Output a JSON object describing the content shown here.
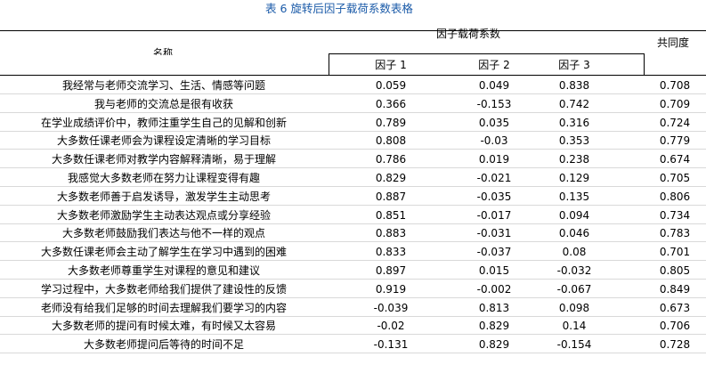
{
  "caption": "表 6 旋转后因子载荷系数表格",
  "header": {
    "name_label": "名称",
    "group_label": "因子载荷系数",
    "factor_labels": [
      "因子 1",
      "因子 2",
      "因子 3"
    ],
    "communality_label": "共同度"
  },
  "rows": [
    {
      "name": "我经常与老师交流学习、生活、情感等问题",
      "f1": "0.059",
      "f2": "0.049",
      "f3": "0.838",
      "h": "0.708"
    },
    {
      "name": "我与老师的交流总是很有收获",
      "f1": "0.366",
      "f2": "-0.153",
      "f3": "0.742",
      "h": "0.709"
    },
    {
      "name": "在学业成绩评价中，教师注重学生自己的见解和创新",
      "f1": "0.789",
      "f2": "0.035",
      "f3": "0.316",
      "h": "0.724"
    },
    {
      "name": "大多数任课老师会为课程设定清晰的学习目标",
      "f1": "0.808",
      "f2": "-0.03",
      "f3": "0.353",
      "h": "0.779"
    },
    {
      "name": "大多数任课老师对教学内容解释清晰，易于理解",
      "f1": "0.786",
      "f2": "0.019",
      "f3": "0.238",
      "h": "0.674"
    },
    {
      "name": "我感觉大多数老师在努力让课程变得有趣",
      "f1": "0.829",
      "f2": "-0.021",
      "f3": "0.129",
      "h": "0.705"
    },
    {
      "name": "大多数老师善于启发诱导，激发学生主动思考",
      "f1": "0.887",
      "f2": "-0.035",
      "f3": "0.135",
      "h": "0.806"
    },
    {
      "name": "大多数老师激励学生主动表达观点或分享经验",
      "f1": "0.851",
      "f2": "-0.017",
      "f3": "0.094",
      "h": "0.734"
    },
    {
      "name": "大多数老师鼓励我们表达与他不一样的观点",
      "f1": "0.883",
      "f2": "-0.031",
      "f3": "0.046",
      "h": "0.783"
    },
    {
      "name": "大多数任课老师会主动了解学生在学习中遇到的困难",
      "f1": "0.833",
      "f2": "-0.037",
      "f3": "0.08",
      "h": "0.701"
    },
    {
      "name": "大多数老师尊重学生对课程的意见和建议",
      "f1": "0.897",
      "f2": "0.015",
      "f3": "-0.032",
      "h": "0.805"
    },
    {
      "name": "学习过程中，大多数老师给我们提供了建设性的反馈",
      "f1": "0.919",
      "f2": "-0.002",
      "f3": "-0.067",
      "h": "0.849"
    },
    {
      "name": "老师没有给我们足够的时间去理解我们要学习的内容",
      "f1": "-0.039",
      "f2": "0.813",
      "f3": "0.098",
      "h": "0.673"
    },
    {
      "name": "大多数老师的提问有时候太难，有时候又太容易",
      "f1": "-0.02",
      "f2": "0.829",
      "f3": "0.14",
      "h": "0.706"
    },
    {
      "name": "大多数老师提问后等待的时间不足",
      "f1": "-0.131",
      "f2": "0.829",
      "f3": "-0.154",
      "h": "0.728"
    }
  ]
}
